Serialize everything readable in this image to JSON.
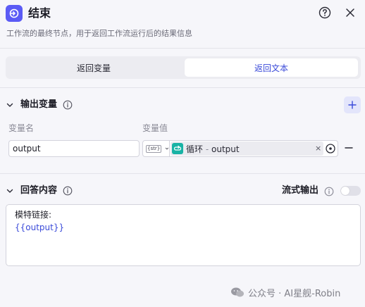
{
  "header": {
    "title": "结束",
    "description": "工作流的最终节点，用于返回工作流运行后的结果信息",
    "node_icon": "end-node-icon",
    "help_icon": "question-circle-icon",
    "close_icon": "close-icon"
  },
  "tabs": [
    {
      "label": "返回变量",
      "active": false
    },
    {
      "label": "返回文本",
      "active": true
    }
  ],
  "output_section": {
    "title": "输出变量",
    "col_name": "变量名",
    "col_value": "变量值",
    "rows": [
      {
        "name": "output",
        "type_badge": "{str}",
        "ref_node": "循环",
        "ref_sep": "-",
        "ref_var": "output",
        "clear": "×"
      }
    ]
  },
  "answer_section": {
    "title": "回答内容",
    "stream_label": "流式输出",
    "stream_enabled": false,
    "content_line1": "模特链接:",
    "content_line2": "{{output}}"
  },
  "watermark": {
    "text": "公众号 · AI星舰-Robin"
  },
  "colors": {
    "accent": "#3a4ad9",
    "node_icon_bg": "#5b5bf5",
    "loop_icon_bg": "#19b3a5"
  }
}
